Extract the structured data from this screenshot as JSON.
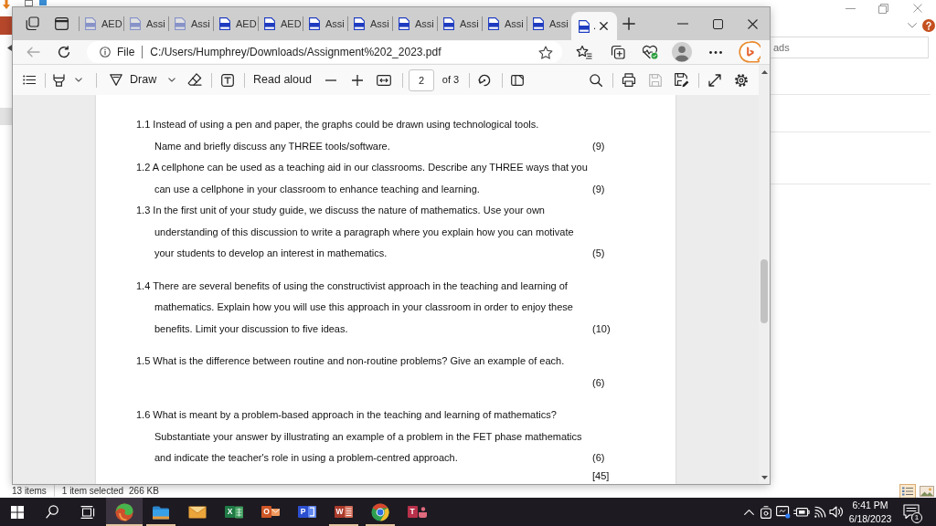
{
  "explorer": {
    "search": {
      "placeholder": "ads"
    },
    "views": [
      {
        "selected": true
      },
      {
        "selected": false
      }
    ],
    "status_bar": {
      "item_count": "13 items",
      "selection": "1 item selected",
      "size": "266 KB"
    }
  },
  "browser": {
    "tabs": [
      {
        "title": "AED",
        "sleeping": true,
        "selected": false
      },
      {
        "title": "Assi",
        "sleeping": true,
        "selected": false
      },
      {
        "title": "Assi",
        "sleeping": true,
        "selected": false
      },
      {
        "title": "AED",
        "sleeping": false,
        "selected": false
      },
      {
        "title": "AED",
        "sleeping": false,
        "selected": false
      },
      {
        "title": "Assi",
        "sleeping": false,
        "selected": false
      },
      {
        "title": "Assi",
        "sleeping": false,
        "selected": false
      },
      {
        "title": "Assi",
        "sleeping": false,
        "selected": false
      },
      {
        "title": "Assi",
        "sleeping": false,
        "selected": false
      },
      {
        "title": "Assi",
        "sleeping": false,
        "selected": false
      },
      {
        "title": "Assi",
        "sleeping": false,
        "selected": false
      },
      {
        "title": ".",
        "sleeping": false,
        "selected": true
      }
    ],
    "back_disabled": true,
    "address": {
      "scheme": "File",
      "url": "C:/Users/Humphrey/Downloads/Assignment%202_2023.pdf"
    },
    "pdf_toolbar": {
      "draw_label": "Draw",
      "read_aloud_label": "Read aloud",
      "page_number": "2",
      "page_count": "of 3",
      "save_disabled": true
    },
    "document": {
      "questions": [
        {
          "lines": [
            {
              "text": "1.1 Instead of using a pen and paper, the graphs could be drawn using technological tools."
            },
            {
              "text": "Name and briefly discuss any THREE tools/software.",
              "marks": "(9)"
            }
          ]
        },
        {
          "lines": [
            {
              "text": "1.2 A cellphone can be used as a teaching aid in our classrooms. Describe any THREE ways that you"
            },
            {
              "text": "can use a cellphone in your classroom to enhance teaching and learning.",
              "marks": "(9)"
            }
          ]
        },
        {
          "lines": [
            {
              "text": "1.3 In the first unit of your study guide, we discuss the nature of mathematics. Use your own"
            },
            {
              "text": "understanding of this discussion to write a paragraph where you explain how you can motivate"
            },
            {
              "text": "your students to develop an interest in mathematics.",
              "marks": "(5)"
            }
          ]
        },
        {
          "lines": [
            {
              "text": "1.4 There are several benefits of using the constructivist approach in the teaching and learning of"
            },
            {
              "text": "mathematics. Explain how you will use this approach in your classroom in order to enjoy these"
            },
            {
              "text": "benefits. Limit your discussion to five ideas.",
              "marks": "(10)"
            }
          ]
        },
        {
          "lines": [
            {
              "text": "1.5 What is the difference between routine and non-routine problems? Give an example of each."
            },
            {
              "marks": "(6)"
            }
          ]
        },
        {
          "lines": [
            {
              "text": "1.6 What is meant by a problem-based approach in the teaching and learning of mathematics?"
            },
            {
              "text": "Substantiate your answer by illustrating an example of a problem in the FET phase mathematics"
            },
            {
              "text": "and indicate the teacher's role in using a problem-centred approach.",
              "marks": "(6)"
            }
          ]
        }
      ],
      "total": "[45]"
    }
  },
  "taskbar": {
    "apps": [
      {
        "running": true,
        "active": true
      },
      {
        "running": true,
        "active": false
      },
      {
        "running": false,
        "active": false
      },
      {
        "letter": "X",
        "running": false,
        "active": false
      },
      {
        "letter": "O",
        "running": false,
        "active": false
      },
      {
        "letter": "P",
        "running": false,
        "active": false
      },
      {
        "letter": "W",
        "running": true,
        "active": false
      },
      {
        "running": true,
        "active": false
      },
      {
        "letter": "T",
        "running": false,
        "active": false
      }
    ],
    "clock": {
      "time": "6:41 PM",
      "date": "6/18/2023"
    },
    "notification_count": "1"
  }
}
